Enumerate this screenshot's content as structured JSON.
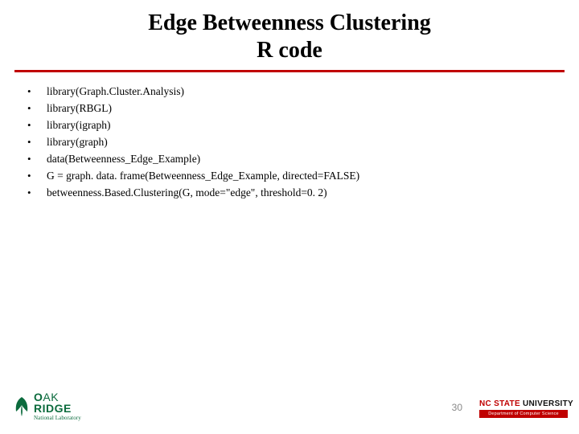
{
  "title": {
    "line1": "Edge Betweenness Clustering",
    "line2": "R code"
  },
  "code_lines": [
    "library(Graph.Cluster.Analysis)",
    "library(RBGL)",
    "library(igraph)",
    "library(graph)",
    "data(Betweenness_Edge_Example)",
    "G = graph. data. frame(Betweenness_Edge_Example, directed=FALSE)",
    " betweenness.Based.Clustering(G, mode=\"edge\", threshold=0. 2)"
  ],
  "page_number": "30",
  "logos": {
    "oak_ridge": {
      "word1a": "O",
      "word1b": "AK",
      "word2a": "R",
      "word2b": "IDGE",
      "sub": "National Laboratory"
    },
    "ncsu": {
      "part1": "NC STATE",
      "part2": " UNIVERSITY",
      "dept": "Department of Computer Science"
    }
  }
}
